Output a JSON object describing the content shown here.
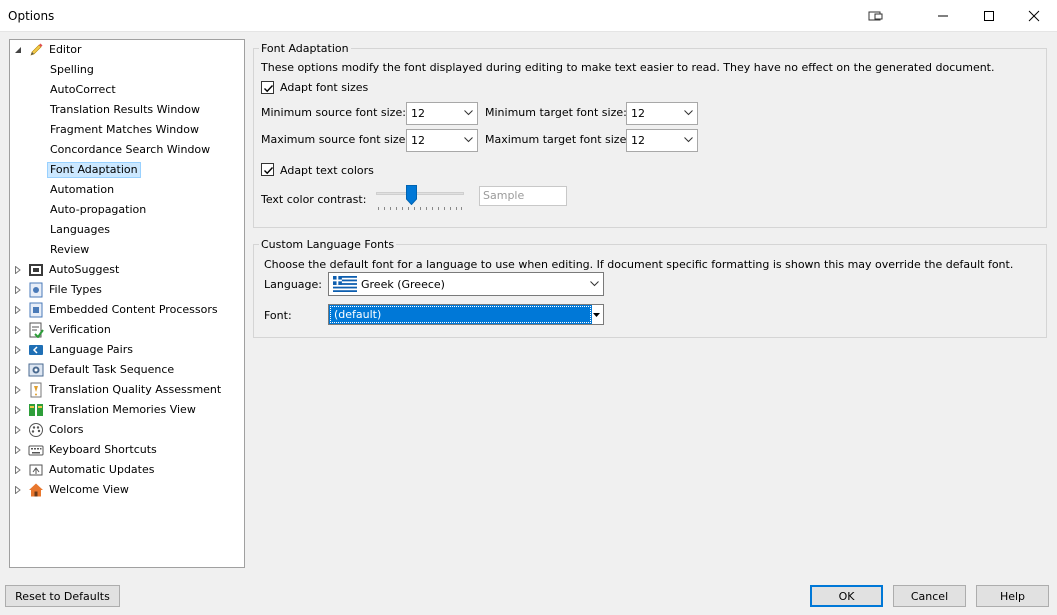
{
  "window": {
    "title": "Options"
  },
  "tree": {
    "editor": {
      "label": "Editor",
      "icon": "pencil-icon"
    },
    "editor_children": [
      {
        "label": "Spelling"
      },
      {
        "label": "AutoCorrect"
      },
      {
        "label": "Translation Results Window"
      },
      {
        "label": "Fragment Matches Window"
      },
      {
        "label": "Concordance Search Window"
      },
      {
        "label": "Font Adaptation",
        "selected": true
      },
      {
        "label": "Automation"
      },
      {
        "label": "Auto-propagation"
      },
      {
        "label": "Languages"
      },
      {
        "label": "Review"
      }
    ],
    "top_nodes": [
      {
        "label": "AutoSuggest",
        "icon": "autosuggest-icon"
      },
      {
        "label": "File Types",
        "icon": "file-types-icon"
      },
      {
        "label": "Embedded Content Processors",
        "icon": "embedded-content-icon"
      },
      {
        "label": "Verification",
        "icon": "verification-icon"
      },
      {
        "label": "Language Pairs",
        "icon": "language-pairs-icon"
      },
      {
        "label": "Default Task Sequence",
        "icon": "task-sequence-icon"
      },
      {
        "label": "Translation Quality Assessment",
        "icon": "quality-assessment-icon"
      },
      {
        "label": "Translation Memories View",
        "icon": "translation-memories-icon"
      },
      {
        "label": "Colors",
        "icon": "palette-icon"
      },
      {
        "label": "Keyboard Shortcuts",
        "icon": "keyboard-icon"
      },
      {
        "label": "Automatic Updates",
        "icon": "updates-icon"
      },
      {
        "label": "Welcome View",
        "icon": "home-icon"
      }
    ]
  },
  "font_adaptation": {
    "title": "Font Adaptation",
    "description": "These options modify the font displayed during editing to make text easier to read. They have no effect on the generated document.",
    "adapt_sizes": {
      "label": "Adapt font sizes",
      "checked": true
    },
    "min_source": {
      "label": "Minimum source font size:",
      "value": "12"
    },
    "min_target": {
      "label": "Minimum target font size:",
      "value": "12"
    },
    "max_source": {
      "label": "Maximum source font size:",
      "value": "12"
    },
    "max_target": {
      "label": "Maximum target font size:",
      "value": "12"
    },
    "adapt_colors": {
      "label": "Adapt text colors",
      "checked": true
    },
    "contrast": {
      "label": "Text color contrast:",
      "level": 0.4,
      "sample_placeholder": "Sample"
    }
  },
  "custom_fonts": {
    "title": "Custom Language Fonts",
    "description": "Choose the default font for a language to use when editing. If document specific formatting is shown this may override the default font.",
    "language": {
      "label": "Language:",
      "value": "Greek (Greece)",
      "flag": "greece-flag-icon"
    },
    "font": {
      "label": "Font:",
      "value": "(default)"
    }
  },
  "buttons": {
    "reset": "Reset to Defaults",
    "ok": "OK",
    "cancel": "Cancel",
    "help": "Help"
  },
  "colors": {
    "accent": "#0078d7",
    "selection": "#cce8ff"
  }
}
